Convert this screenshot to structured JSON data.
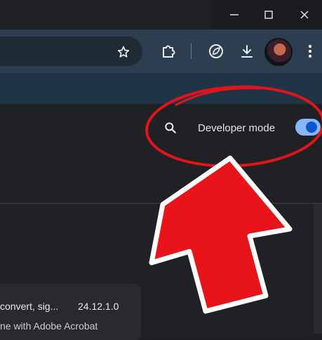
{
  "window": {
    "minimize_icon": "minimize-icon",
    "maximize_icon": "maximize-icon",
    "close_icon": "close-icon"
  },
  "toolbar": {
    "bookmark_icon": "star-icon",
    "extensions_icon": "puzzle-icon",
    "performance_icon": "leaf-icon",
    "downloads_icon": "download-icon",
    "menu_icon": "kebab-menu-icon"
  },
  "extensions_page": {
    "search_icon": "search-icon",
    "developer_mode_label": "Developer mode",
    "developer_mode_enabled": true
  },
  "extension_card": {
    "title_fragment": "convert, sig...",
    "version": "24.12.1.0",
    "description_fragment": "ne with Adobe Acrobat"
  },
  "annotation": {
    "arrow_color": "#e8141a",
    "circle_color": "#e0151b"
  },
  "colors": {
    "toolbar_bg": "#2c3e4f",
    "header_bg": "#1f3447",
    "page_bg": "#202124",
    "toggle_on": "#8ab4f8"
  }
}
